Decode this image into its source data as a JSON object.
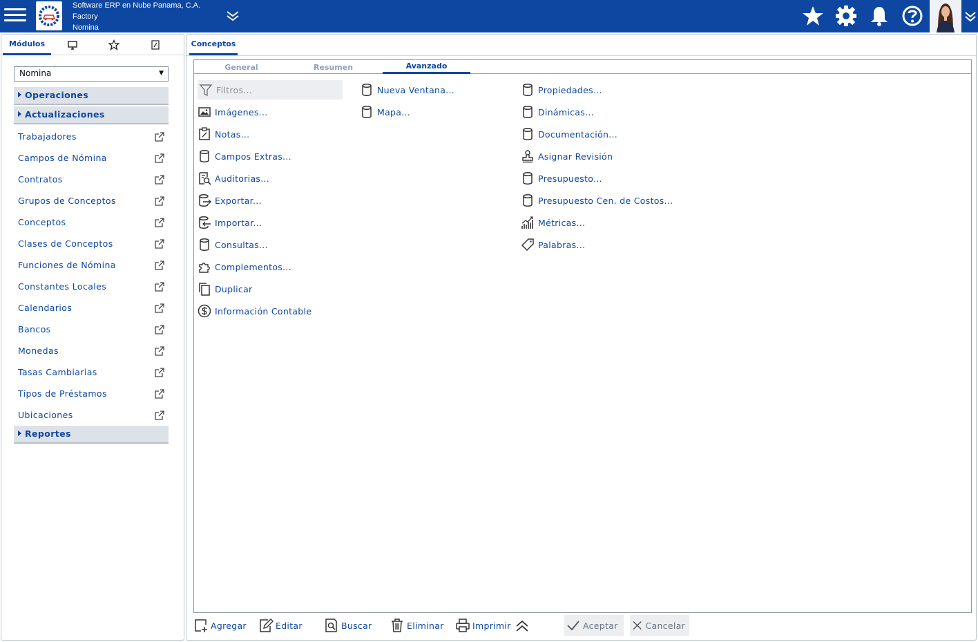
{
  "header": {
    "company_line1": "Software ERP en Nube Panama, C.A.",
    "company_line2": "Factory",
    "company_line3": "Nomina"
  },
  "sidebar": {
    "tabs": [
      {
        "label": "Módulos",
        "icon": null
      },
      {
        "label": "",
        "icon": "monitor-icon"
      },
      {
        "label": "",
        "icon": "star-outline-icon"
      },
      {
        "label": "",
        "icon": "edit-document-icon"
      }
    ],
    "module_select": "Nomina",
    "groups": {
      "operaciones": "Operaciones",
      "actualizaciones": "Actualizaciones",
      "reportes": "Reportes"
    },
    "items": [
      "Trabajadores",
      "Campos de Nómina",
      "Contratos",
      "Grupos de Conceptos",
      "Conceptos",
      "Clases de Conceptos",
      "Funciones de Nómina",
      "Constantes Locales",
      "Calendarios",
      "Bancos",
      "Monedas",
      "Tasas Cambiarias",
      "Tipos de Préstamos",
      "Ubicaciones"
    ]
  },
  "main": {
    "tab": "Conceptos",
    "subtabs": [
      "General",
      "Resumen",
      "Avanzado"
    ],
    "col1": [
      "Filtros...",
      "Imágenes...",
      "Notas...",
      "Campos Extras...",
      "Auditorias...",
      "Exportar...",
      "Importar...",
      "Consultas...",
      "Complementos...",
      "Duplicar",
      "Información Contable"
    ],
    "col2": [
      "Nueva Ventana...",
      "Mapa..."
    ],
    "col3": [
      "Propiedades...",
      "Dinámicas...",
      "Documentación...",
      "Asignar Revisión",
      "Presupuesto...",
      "Presupuesto Cen. de Costos...",
      "Métricas...",
      "Palabras..."
    ]
  },
  "toolbar": {
    "add": "Agregar",
    "edit": "Editar",
    "search": "Buscar",
    "delete": "Eliminar",
    "print": "Imprimir",
    "accept": "Aceptar",
    "cancel": "Cancelar"
  },
  "colors": {
    "brand": "#0d47a1",
    "group_bg": "#dde2e8",
    "muted": "#8ea3bd"
  }
}
